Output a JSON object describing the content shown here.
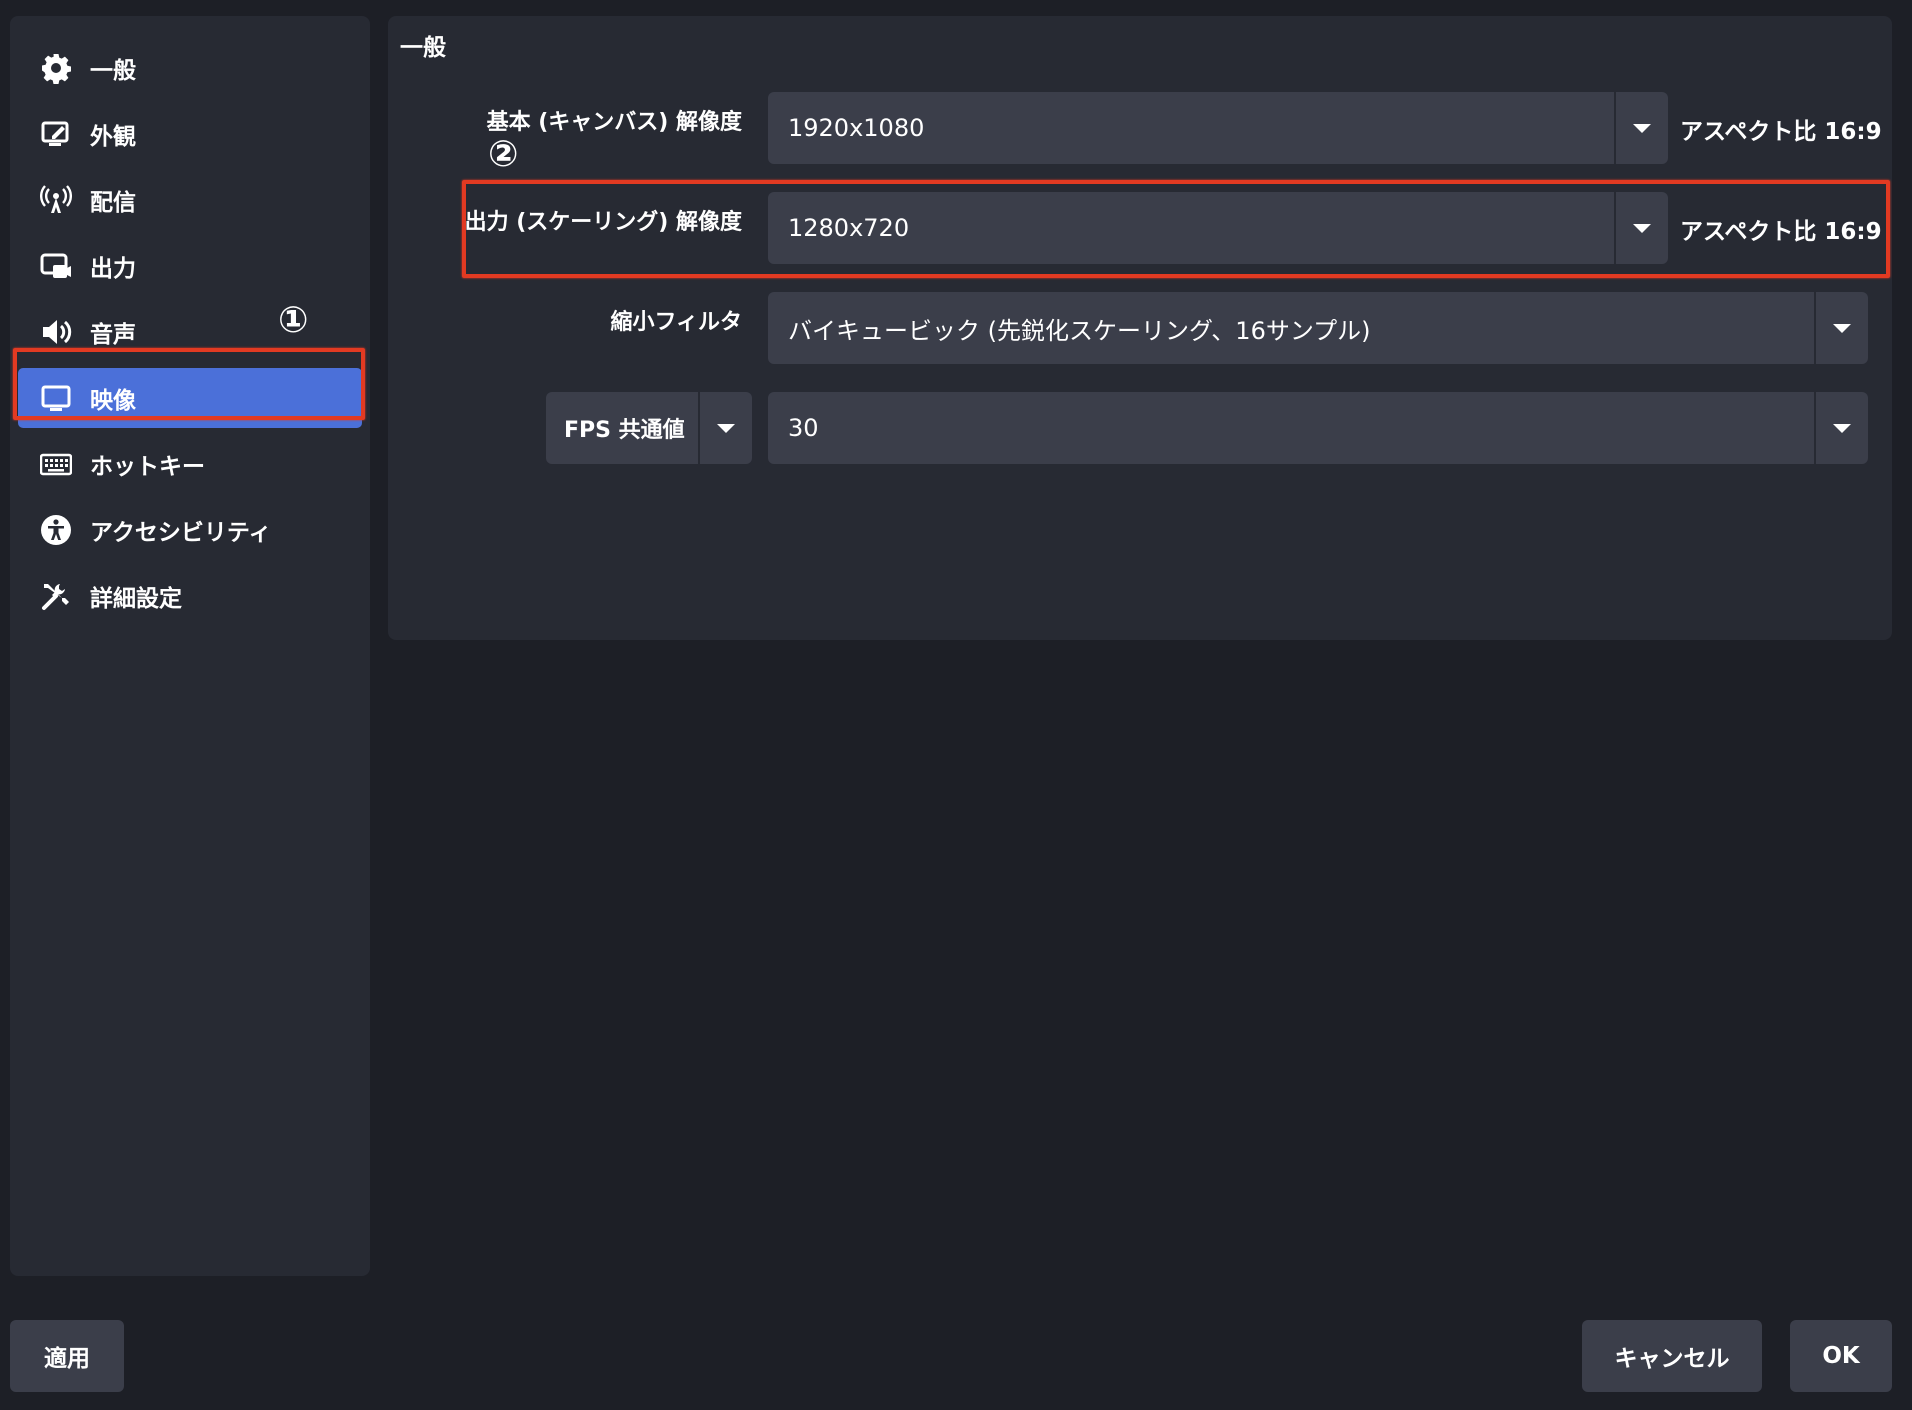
{
  "sidebar": {
    "items": [
      {
        "label": "一般",
        "icon": "gear-icon"
      },
      {
        "label": "外観",
        "icon": "appearance-icon"
      },
      {
        "label": "配信",
        "icon": "broadcast-icon"
      },
      {
        "label": "出力",
        "icon": "output-icon"
      },
      {
        "label": "音声",
        "icon": "speaker-icon"
      },
      {
        "label": "映像",
        "icon": "monitor-icon"
      },
      {
        "label": "ホットキー",
        "icon": "keyboard-icon"
      },
      {
        "label": "アクセシビリティ",
        "icon": "accessibility-icon"
      },
      {
        "label": "詳細設定",
        "icon": "tools-icon"
      }
    ],
    "active_index": 5
  },
  "panel": {
    "title": "一般",
    "base_resolution": {
      "label": "基本 (キャンバス) 解像度",
      "value": "1920x1080",
      "aspect_prefix": "アスペクト比",
      "aspect_value": "16:9"
    },
    "output_resolution": {
      "label": "出力 (スケーリング) 解像度",
      "value": "1280x720",
      "aspect_prefix": "アスペクト比",
      "aspect_value": "16:9"
    },
    "downscale_filter": {
      "label": "縮小フィルタ",
      "value": "バイキュービック (先鋭化スケーリング、16サンプル)"
    },
    "fps": {
      "type_label": "FPS 共通値",
      "value": "30"
    }
  },
  "annotations": {
    "marker1": "①",
    "marker2": "②",
    "highlight_color": "#e23a22"
  },
  "buttons": {
    "apply": "適用",
    "cancel": "キャンセル",
    "ok": "OK"
  },
  "colors": {
    "background": "#1d1f26",
    "panel": "#272a33",
    "field": "#3b3e4a",
    "accent": "#4b70d9"
  }
}
